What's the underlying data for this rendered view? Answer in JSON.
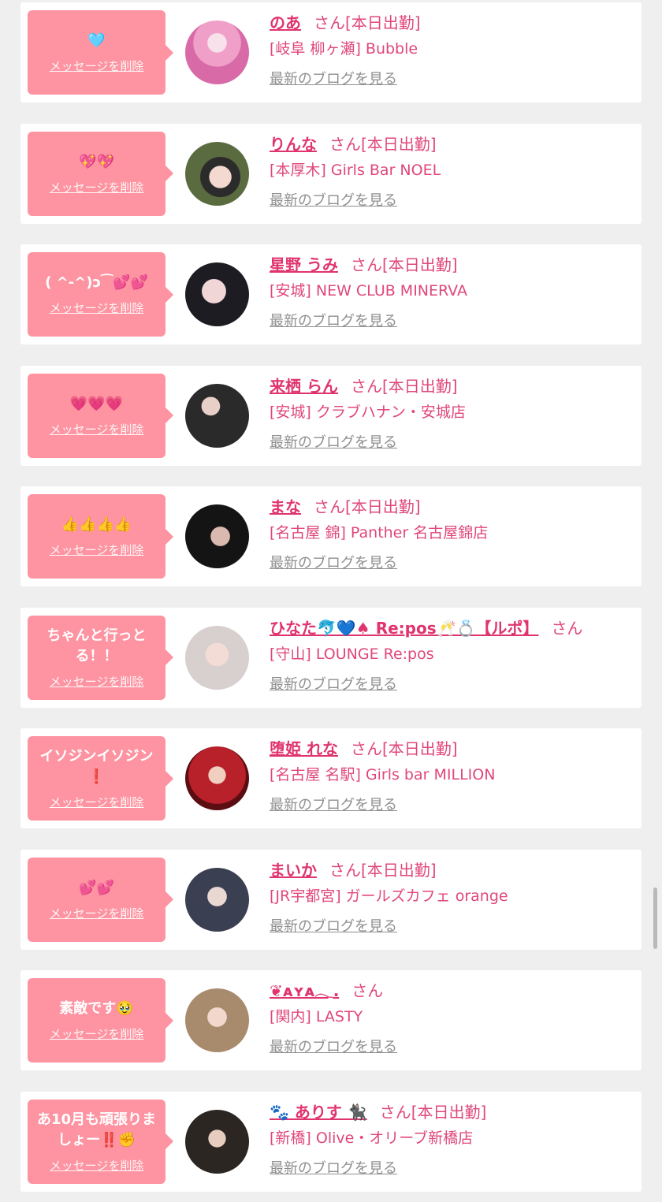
{
  "delete_label": "メッセージを削除",
  "blog_label": "最新のブログを見る",
  "san_label": "さん",
  "colors": {
    "bubble": "#fe93a1",
    "accent": "#e0346e",
    "link_gray": "#8f8f8f"
  },
  "cards": [
    {
      "message": "🩵",
      "name": "のあ",
      "status": "[本日出勤]",
      "shop": "[岐阜 柳ヶ瀬] Bubble"
    },
    {
      "message": "💖💖",
      "name": "りんな",
      "status": "[本日出勤]",
      "shop": "[本厚木] Girls Bar NOEL"
    },
    {
      "message": "( ^-^)ɔ⁀💕💕",
      "name": "星野 うみ",
      "status": "[本日出勤]",
      "shop": "[安城] NEW CLUB MINERVA"
    },
    {
      "message": "💗💗💗",
      "name": "来栖 らん",
      "status": "[本日出勤]",
      "shop": "[安城] クラブハナン・安城店"
    },
    {
      "message": "👍👍👍👍",
      "name": "まな",
      "status": "[本日出勤]",
      "shop": "[名古屋 錦] Panther 名古屋錦店"
    },
    {
      "message": "ちゃんと行っとる！！",
      "name": "ひなた🐬💙♠ Re:pos🥂💍【ルポ】",
      "status": "",
      "shop": "[守山] LOUNGE Re:pos"
    },
    {
      "message": "イソジンイソジン❗",
      "name": "堕姫 れな",
      "status": "[本日出勤]",
      "shop": "[名古屋 名駅] Girls bar MILLION"
    },
    {
      "message": "💕💕",
      "name": "まいか",
      "status": "[本日出勤]",
      "shop": "[JR宇都宮] ガールズカフェ orange"
    },
    {
      "message": "素敵です🥹",
      "name": "❦ᴀʏᴀ𓂃.",
      "status": "",
      "shop": "[関内] LASTY"
    },
    {
      "message": "あ10月も頑張りましょー‼️✊",
      "name": "🐾 ありす 🐈‍⬛",
      "status": "[本日出勤]",
      "shop": "[新橋] Olive・オリーブ新橋店"
    }
  ]
}
